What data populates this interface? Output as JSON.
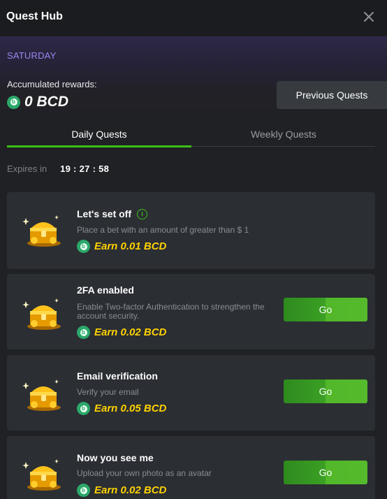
{
  "header": {
    "title": "Quest Hub"
  },
  "summary": {
    "day": "SATURDAY",
    "accumulated_label": "Accumulated rewards:",
    "accumulated_value": "0 BCD",
    "previous_quests_label": "Previous Quests"
  },
  "tabs": [
    {
      "label": "Daily Quests",
      "active": true
    },
    {
      "label": "Weekly Quests",
      "active": false
    }
  ],
  "expires": {
    "label": "Expires in",
    "time": "19 : 27 : 58"
  },
  "quests": [
    {
      "title": "Let's set off",
      "description": "Place a bet with an amount of greater than $ 1",
      "reward": "Earn 0.01 BCD",
      "has_info": true
    },
    {
      "title": "2FA enabled",
      "description": "Enable Two-factor Authentication to strengthen the account security.",
      "reward": "Earn 0.02 BCD",
      "button": "Go"
    },
    {
      "title": "Email verification",
      "description": "Verify your email",
      "reward": "Earn 0.05 BCD",
      "button": "Go"
    },
    {
      "title": "Now you see me",
      "description": "Upload your own photo as an avatar",
      "reward": "Earn 0.02 BCD",
      "button": "Go"
    }
  ],
  "colors": {
    "accent_green": "#3bc117",
    "reward_yellow": "#ffd200",
    "day_purple": "#9d86f2",
    "coin_green": "#2ca86a"
  },
  "icons": {
    "close": "close-icon",
    "coin": "bcd-coin-icon",
    "info": "info-icon",
    "chest": "treasure-chest-icon"
  }
}
